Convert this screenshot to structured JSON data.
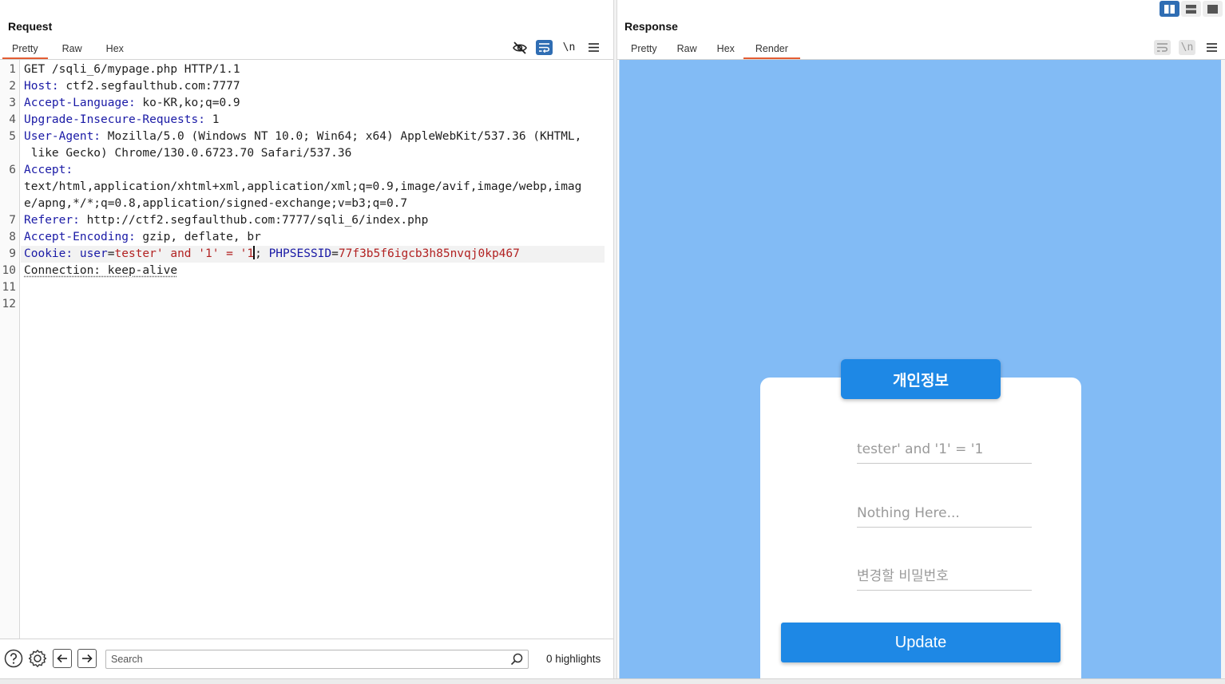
{
  "layout_toggles": [
    "split-vertical-icon",
    "split-horizontal-icon",
    "single-panel-icon"
  ],
  "request": {
    "title": "Request",
    "tabs": [
      {
        "label": "Pretty",
        "active": true
      },
      {
        "label": "Raw",
        "active": false
      },
      {
        "label": "Hex",
        "active": false
      }
    ],
    "toolbar": {
      "newline_label": "\\n"
    },
    "line_numbers": [
      "1",
      "2",
      "3",
      "4",
      "5",
      "6",
      "7",
      "8",
      "9",
      "10",
      "11",
      "12"
    ],
    "lines": {
      "l1": "GET /sqli_6/mypage.php HTTP/1.1",
      "l2_key": "Host:",
      "l2_val": " ctf2.segfaulthub.com:7777",
      "l3_key": "Accept-Language:",
      "l3_val": " ko-KR,ko;q=0.9",
      "l4_key": "Upgrade-Insecure-Requests:",
      "l4_val": " 1",
      "l5_key": "User-Agent:",
      "l5_val": " Mozilla/5.0 (Windows NT 10.0; Win64; x64) AppleWebKit/537.36 (KHTML,",
      "l5_cont": " like Gecko) Chrome/130.0.6723.70 Safari/537.36",
      "l6_key": "Accept:",
      "l6_cont1": "text/html,application/xhtml+xml,application/xml;q=0.9,image/avif,image/webp,imag",
      "l6_cont2": "e/apng,*/*;q=0.8,application/signed-exchange;v=b3;q=0.7",
      "l7_key": "Referer:",
      "l7_val": " http://ctf2.segfaulthub.com:7777/sqli_6/index.php",
      "l8_key": "Accept-Encoding:",
      "l8_val": " gzip, deflate, br",
      "l9_key": "Cookie:",
      "l9_name1": " user",
      "l9_eq1": "=",
      "l9_val1a": "tester' and '1' = '1",
      "l9_semi": ";",
      "l9_name2": " PHPSESSID",
      "l9_eq2": "=",
      "l9_val2": "77f3b5f6igcb3h85nvqj0kp467",
      "l10": "Connection: keep-alive"
    },
    "search": {
      "placeholder": "Search",
      "highlights": "0 highlights"
    }
  },
  "response": {
    "title": "Response",
    "tabs": [
      {
        "label": "Pretty",
        "active": false
      },
      {
        "label": "Raw",
        "active": false
      },
      {
        "label": "Hex",
        "active": false
      },
      {
        "label": "Render",
        "active": true
      }
    ],
    "toolbar": {
      "newline_label": "\\n"
    },
    "render": {
      "header": "개인정보",
      "fields": [
        {
          "placeholder": "tester' and '1' = '1"
        },
        {
          "placeholder": "Nothing Here..."
        },
        {
          "placeholder": "변경할 비밀번호"
        }
      ],
      "button": "Update"
    }
  },
  "colors": {
    "accent": "#2f6db3",
    "tab_underline": "#e35d33",
    "header_name": "#1a1aa6",
    "cookie_value": "#b22222",
    "render_background": "#82bbf5",
    "render_button": "#1e88e5"
  }
}
